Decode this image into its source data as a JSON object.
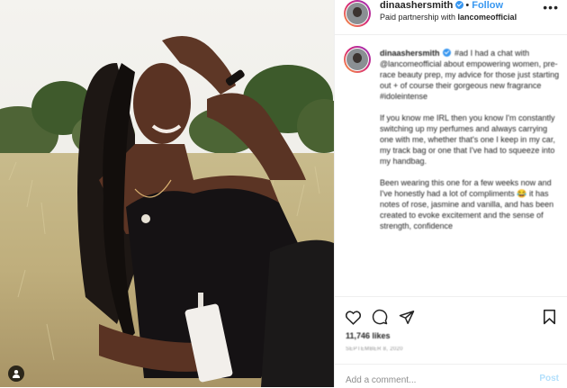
{
  "post": {
    "username": "dinaashersmith",
    "follow_label": "Follow",
    "separator": "•",
    "partnership_prefix": "Paid partnership with ",
    "partner": "lancomeofficial",
    "more_icon": "more-horizontal-icon"
  },
  "caption": {
    "username": "dinaashersmith",
    "paragraphs": [
      "#ad I had a chat with @lancomeofficial about empowering women, pre-race beauty prep, my advice for those just starting out + of course their gorgeous new fragrance #idoleintense",
      "If you know me IRL then you know I'm constantly switching up my perfumes and always carrying one with me, whether that's one I keep in my car, my track bag or one that I've had to squeeze into my handbag.",
      "Been wearing this one for a few weeks now and I've honestly had a lot of compliments 😂 it has notes of rose, jasmine and vanilla, and has been created to evoke excitement and the sense of strength, confidence"
    ]
  },
  "actions": {
    "icons": [
      "heart-icon",
      "comment-icon",
      "share-icon",
      "bookmark-icon"
    ],
    "likes": "11,746 likes",
    "date": "SEPTEMBER 8, 2020"
  },
  "comment": {
    "placeholder": "Add a comment...",
    "post_label": "Post"
  },
  "colors": {
    "link_blue": "#3897f0",
    "post_disabled": "#b2dffc",
    "border": "#efefef",
    "muted": "#8e8e8e"
  }
}
